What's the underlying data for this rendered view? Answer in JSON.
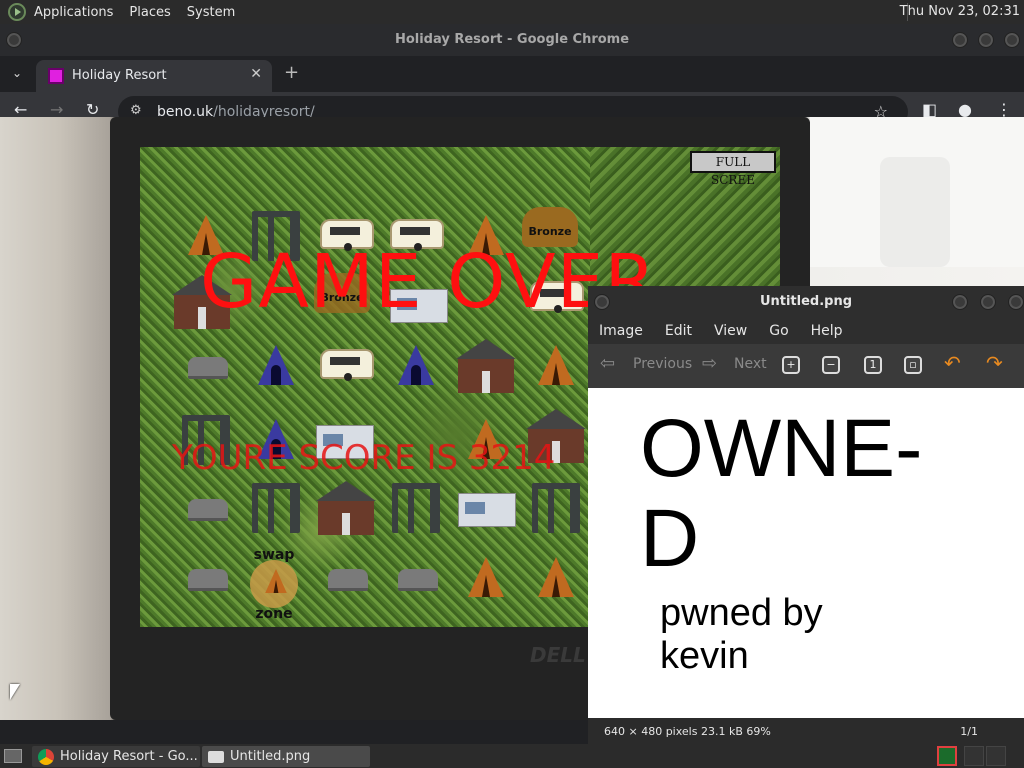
{
  "top_panel": {
    "menu": [
      "Applications",
      "Places",
      "System"
    ],
    "clock": "Thu Nov 23, 02:31"
  },
  "chrome": {
    "window_title": "Holiday Resort - Google Chrome",
    "tab_title": "Holiday Resort",
    "url_domain": "beno.uk",
    "url_path": "/holidayresort/"
  },
  "game": {
    "fullscreen_label": "FULL SCREE",
    "game_over_text": "GAME OVER",
    "score_text": "YOURE SCORE IS 3214",
    "bronze_label": "Bronze",
    "swap_label": "swap",
    "zone_label": "zone"
  },
  "laptop": {
    "brand": "DELL"
  },
  "viewer": {
    "title": "Untitled.png",
    "menu": [
      "Image",
      "Edit",
      "View",
      "Go",
      "Help"
    ],
    "prev_label": "Previous",
    "next_label": "Next",
    "image_line1": "OWNE-",
    "image_line2": "D",
    "image_line3": "pwned by",
    "image_line4": "kevin",
    "status_info": "640 × 480 pixels  23.1 kB   69%",
    "status_page": "1/1"
  },
  "taskbar": {
    "chrome_task": "Holiday Resort - Go...",
    "viewer_task": "Untitled.png"
  },
  "colors": {
    "game_over": "#ff1010",
    "tab_favicon": "#e020e0",
    "viewer_arrows": "#e88a20"
  }
}
